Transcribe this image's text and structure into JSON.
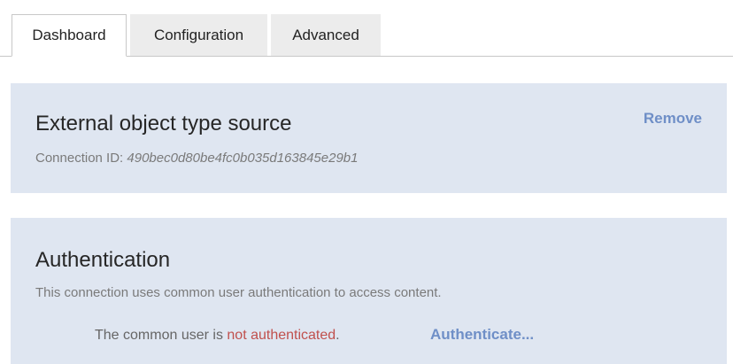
{
  "tabs": [
    {
      "label": "Dashboard",
      "active": true
    },
    {
      "label": "Configuration",
      "active": false
    },
    {
      "label": "Advanced",
      "active": false
    }
  ],
  "source_panel": {
    "title": "External object type source",
    "connection_id_label": "Connection ID: ",
    "connection_id_value": "490bec0d80be4fc0b035d163845e29b1",
    "remove_label": "Remove"
  },
  "auth_panel": {
    "title": "Authentication",
    "description": "This connection uses common user authentication to access content.",
    "status_prefix": "The common user is ",
    "status_value": "not authenticated",
    "status_suffix": ".",
    "authenticate_label": "Authenticate..."
  },
  "colors": {
    "panel_background": "#dfe6f1",
    "link": "#6f8fc7",
    "status_error": "#c0504d"
  }
}
